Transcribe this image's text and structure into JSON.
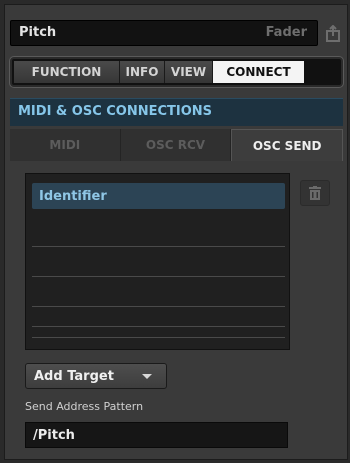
{
  "header": {
    "name": "Pitch",
    "type": "Fader"
  },
  "tabs": [
    {
      "label": "FUNCTION",
      "active": false
    },
    {
      "label": "INFO",
      "active": false
    },
    {
      "label": "VIEW",
      "active": false
    },
    {
      "label": "CONNECT",
      "active": true
    }
  ],
  "section_title": "MIDI & OSC CONNECTIONS",
  "subtabs": [
    {
      "label": "MIDI",
      "active": false
    },
    {
      "label": "OSC RCV",
      "active": false
    },
    {
      "label": "OSC SEND",
      "active": true
    }
  ],
  "targets": {
    "items": [
      "Identifier"
    ],
    "selected": 0
  },
  "add_target_label": "Add Target",
  "pattern": {
    "label": "Send Address Pattern",
    "value": "/Pitch"
  },
  "icons": {
    "share": "share-icon",
    "trash": "trash-icon",
    "dropdown": "chevron-down-icon"
  },
  "colors": {
    "accent": "#86c6e9",
    "section_bg": "#1d3240",
    "selected_row": "#2c4455"
  }
}
